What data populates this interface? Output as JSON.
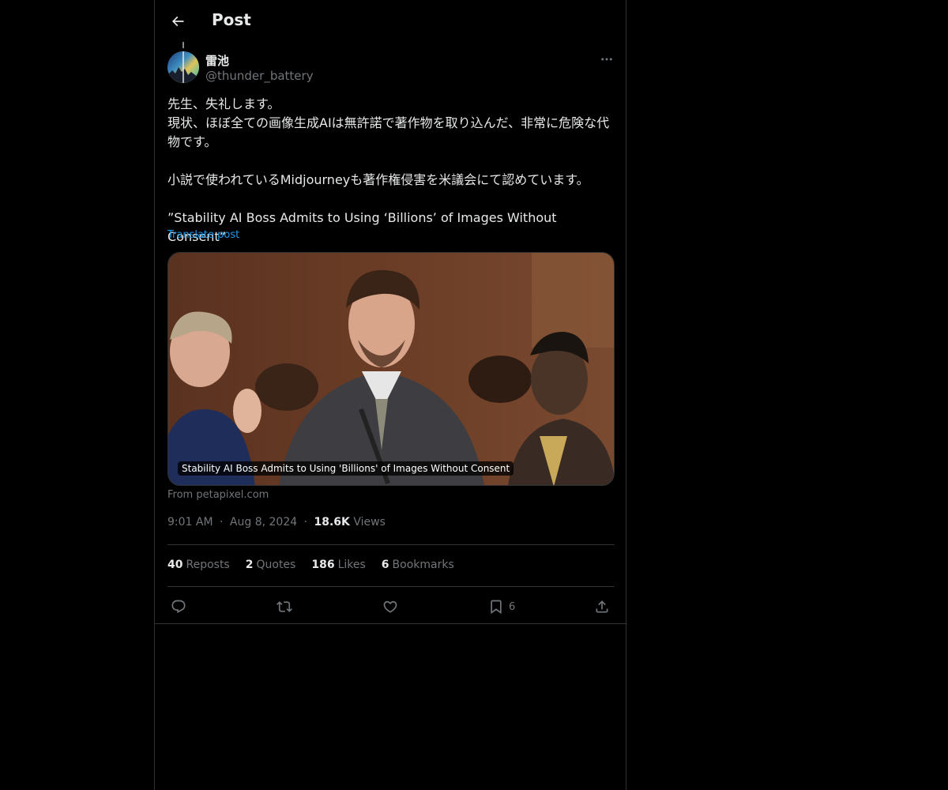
{
  "header": {
    "title": "Post",
    "back_icon": "arrow-left-icon"
  },
  "post": {
    "author_name": "雷池",
    "author_handle": "@thunder_battery",
    "text": "先生、失礼します。\n現状、ほぼ全ての画像生成AIは無許諾で著作物を取り込んだ、非常に危険な代物です。\n\n小説で使われているMidjourneyも著作権侵害を米議会にて認めています。\n\n”Stability AI Boss Admits to Using ‘Billions’ of Images Without Consent”",
    "translate_label": "Translate post",
    "media_caption": "Stability AI Boss Admits to Using 'Billions' of Images Without Consent",
    "source": "From petapixel.com",
    "time": "9:01 AM",
    "date": "Aug 8, 2024",
    "separator": "·",
    "views_count": "18.6K",
    "views_label": "Views"
  },
  "stats": {
    "reposts_count": "40",
    "reposts_label": "Reposts",
    "quotes_count": "2",
    "quotes_label": "Quotes",
    "likes_count": "186",
    "likes_label": "Likes",
    "bookmarks_count": "6",
    "bookmarks_label": "Bookmarks"
  },
  "actions": {
    "reply_icon": "reply-icon",
    "repost_icon": "repost-icon",
    "like_icon": "heart-icon",
    "bookmark_icon": "bookmark-icon",
    "bookmark_count": "6",
    "share_icon": "share-icon"
  },
  "colors": {
    "background": "#000000",
    "text": "#e7e9ea",
    "muted": "#71767b",
    "link": "#1d9bf0",
    "border": "#2f3336"
  }
}
